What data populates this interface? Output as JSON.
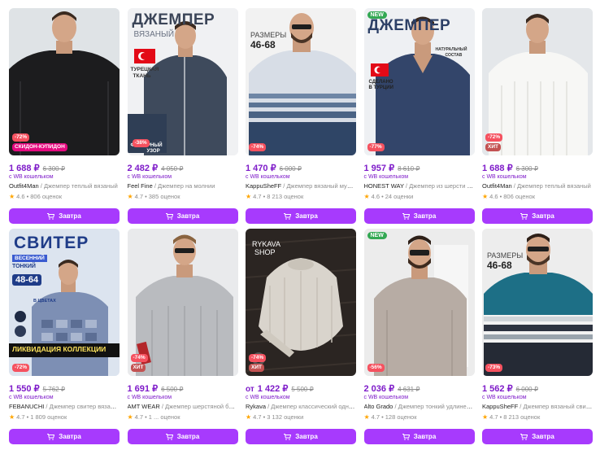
{
  "products": [
    {
      "price": "1 688 ₽",
      "old_price": "6 300 ₽",
      "wallet": "с WB кошельком",
      "brand": "Outfit4Man",
      "name": "Джемпер теплый вязаный",
      "rating": "4.6",
      "reviews": "806 оценок",
      "discount": "-72%",
      "promo": "СКИДОН-КУПИДОН",
      "button": "Завтра",
      "overlay": []
    },
    {
      "price": "2 482 ₽",
      "old_price": "4 050 ₽",
      "wallet": "с WB кошельком",
      "brand": "Feel Fine",
      "name": "Джемпер на молнии",
      "rating": "4.7",
      "reviews": "385 оценок",
      "discount": "-38%",
      "button": "Завтра",
      "overlay": [
        "ДЖЕМПЕР",
        "ВЯЗАНЫЙ",
        "ТУРЕЦКАЯ",
        "ТКАНЬ",
        "ФАКТУРНЫЙ",
        "УЗОР"
      ]
    },
    {
      "price": "1 470 ₽",
      "old_price": "6 000 ₽",
      "wallet": "с WB кошельком",
      "brand": "KappuSheFF",
      "name": "Джемпер вязаный мужско...",
      "rating": "4.7",
      "reviews": "8 213 оценок",
      "discount": "-74%",
      "button": "Завтра",
      "overlay": [
        "РАЗМЕРЫ",
        "46-68"
      ]
    },
    {
      "price": "1 957 ₽",
      "old_price": "8 610 ₽",
      "wallet": "с WB кошельком",
      "brand": "HONEST WAY",
      "name": "Джемпер из шерсти мер...",
      "rating": "4.6",
      "reviews": "24 оценки",
      "is_new": "NEW",
      "discount": "-77%",
      "button": "Завтра",
      "overlay": [
        "ДЖЕМПЕР",
        "НАТУРАЛЬНЫЙ",
        "СОСТАВ",
        "СДЕЛАНО",
        "В ТУРЦИИ"
      ]
    },
    {
      "price": "1 688 ₽",
      "old_price": "6 300 ₽",
      "wallet": "с WB кошельком",
      "brand": "Outfit4Man",
      "name": "Джемпер теплый вязаный",
      "rating": "4.6",
      "reviews": "806 оценок",
      "discount": "-72%",
      "tag": "ХИТ",
      "button": "Завтра",
      "overlay": []
    },
    {
      "price": "1 550 ₽",
      "old_price": "5 762 ₽",
      "wallet": "с WB кошельком",
      "brand": "FEBANUCHI",
      "name": "Джемпер свитер вязаный т...",
      "rating": "4.7",
      "reviews": "1 809 оценок",
      "discount": "-72%",
      "button": "Завтра",
      "overlay": [
        "СВИТЕР",
        "ВЕСЕННИЙ",
        "ТОНКИЙ",
        "48-64",
        "В ЦВЕТАХ",
        "ЛИКВИДАЦИЯ КОЛЛЕКЦИИ"
      ]
    },
    {
      "price": "1 691 ₽",
      "old_price": "6 500 ₽",
      "wallet": "с WB кошельком",
      "brand": "AMT WEAR",
      "name": "Джемпер шерстяной больш...",
      "rating": "4.7",
      "reviews": "1 ... оценок",
      "discount": "-74%",
      "tag": "ХИТ",
      "button": "Завтра",
      "overlay": []
    },
    {
      "price_prefix": "от",
      "price": "1 422 ₽",
      "old_price": "5 500 ₽",
      "wallet": "с WB кошельком",
      "brand": "Rykava",
      "name": "Джемпер классический одното...",
      "rating": "4.7",
      "reviews": "3 132 оценки",
      "discount": "-74%",
      "tag": "ХИТ",
      "button": "Завтра",
      "overlay": [
        "RYKAVA",
        "SHOP"
      ]
    },
    {
      "price": "2 036 ₽",
      "old_price": "4 631 ₽",
      "wallet": "с WB кошельком",
      "brand": "Alto Grado",
      "name": "Джемпер тонкий удлиненный",
      "rating": "4.7",
      "reviews": "128 оценок",
      "is_new": "NEW",
      "discount": "-56%",
      "button": "Завтра",
      "overlay": []
    },
    {
      "price": "1 562 ₽",
      "old_price": "6 000 ₽",
      "wallet": "с WB кошельком",
      "brand": "KappuSheFF",
      "name": "Джемпер вязаный свитер",
      "rating": "4.7",
      "reviews": "8 213 оценок",
      "discount": "-73%",
      "button": "Завтра",
      "overlay": [
        "РАЗМЕРЫ",
        "46-68"
      ]
    }
  ],
  "colors": {
    "accent": "#a73afd",
    "price": "#7e1bc9",
    "discount": "#f5515f",
    "new": "#33a853"
  },
  "icons": {
    "button": "cart-icon",
    "rating": "star-icon"
  }
}
